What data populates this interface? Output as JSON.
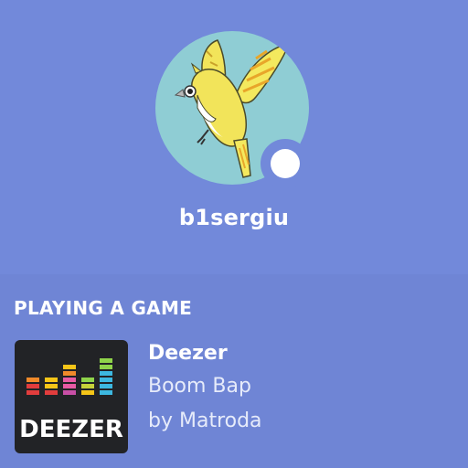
{
  "profile": {
    "username": "b1sergiu",
    "avatar_icon": "canary-bird-avatar",
    "status": "online",
    "status_color": "#ffffff"
  },
  "activity": {
    "header": "PLAYING A GAME",
    "game": {
      "icon": "deezer-logo-icon",
      "logo_text": "DEEZER",
      "name": "Deezer",
      "details": "Boom Bap",
      "state": "by Matroda"
    }
  },
  "colors": {
    "header_bg": "#7289da",
    "activity_bg": "#6f85d5",
    "avatar_bg": "#8fcdd4",
    "icon_bg": "#222326"
  }
}
